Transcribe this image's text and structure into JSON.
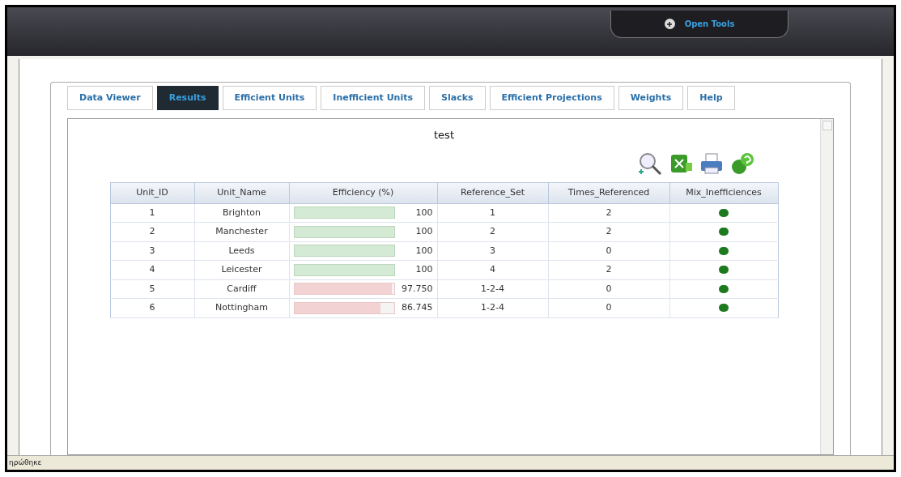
{
  "top_bar": {
    "tools_button": "Open Tools"
  },
  "tabs": [
    {
      "label": "Data Viewer",
      "selected": false
    },
    {
      "label": "Results",
      "selected": true
    },
    {
      "label": "Efficient Units",
      "selected": false
    },
    {
      "label": "Inefficient Units",
      "selected": false
    },
    {
      "label": "Slacks",
      "selected": false
    },
    {
      "label": "Efficient Projections",
      "selected": false
    },
    {
      "label": "Weights",
      "selected": false
    },
    {
      "label": "Help",
      "selected": false
    }
  ],
  "results": {
    "title": "test",
    "table": {
      "columns": [
        "Unit_ID",
        "Unit_Name",
        "Efficiency (%)",
        "Reference_Set",
        "Times_Referenced",
        "Mix_Inefficiences"
      ],
      "rows": [
        {
          "id": "1",
          "name": "Brighton",
          "efficiency": "100",
          "level": 1,
          "efficient": true,
          "reference_set": "1",
          "times_referenced": "2"
        },
        {
          "id": "2",
          "name": "Manchester",
          "efficiency": "100",
          "level": 1,
          "efficient": true,
          "reference_set": "2",
          "times_referenced": "2"
        },
        {
          "id": "3",
          "name": "Leeds",
          "efficiency": "100",
          "level": 1,
          "efficient": true,
          "reference_set": "3",
          "times_referenced": "0"
        },
        {
          "id": "4",
          "name": "Leicester",
          "efficiency": "100",
          "level": 1,
          "efficient": true,
          "reference_set": "4",
          "times_referenced": "2"
        },
        {
          "id": "5",
          "name": "Cardiff",
          "efficiency": "97.750",
          "level": 0.9775,
          "efficient": false,
          "reference_set": "1-2-4",
          "times_referenced": "0"
        },
        {
          "id": "6",
          "name": "Nottingham",
          "efficiency": "86.745",
          "level": 0.86745,
          "efficient": false,
          "reference_set": "1-2-4",
          "times_referenced": "0"
        }
      ]
    }
  },
  "status_bar": {
    "text": "ηρώθηκε"
  }
}
